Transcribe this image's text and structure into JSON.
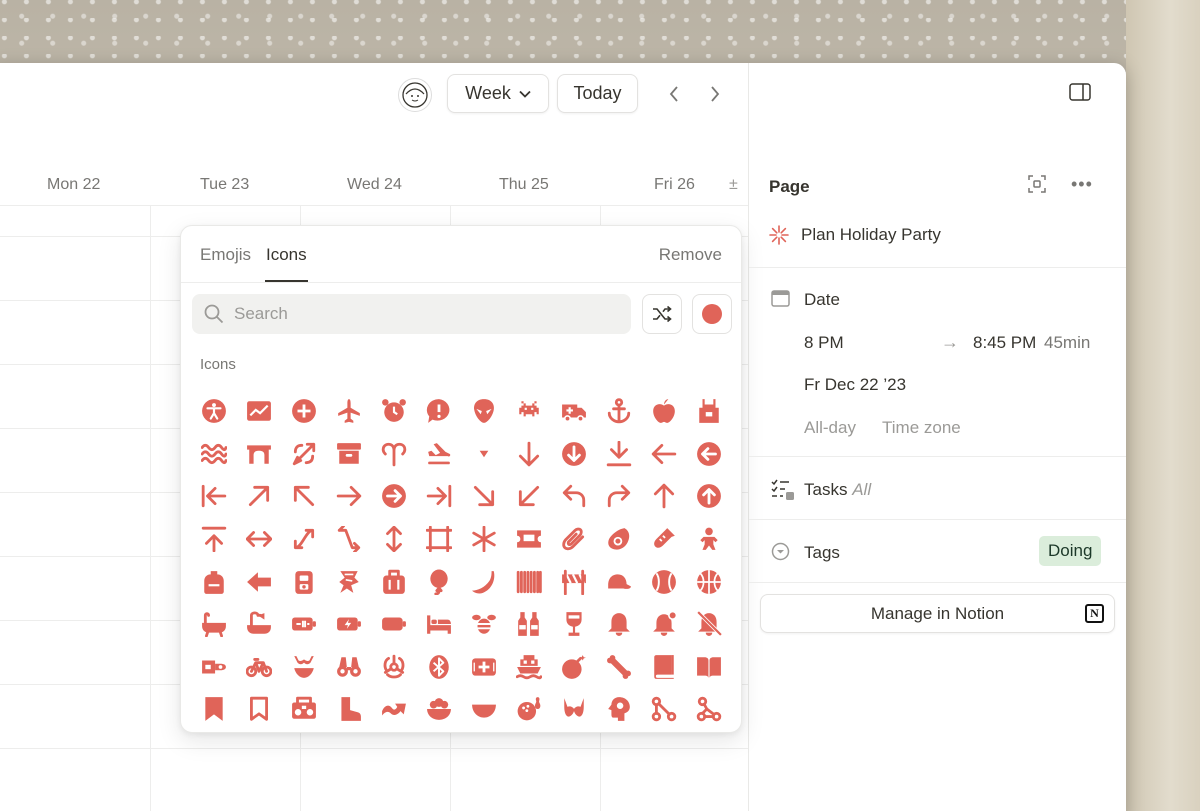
{
  "colors": {
    "accent": "#e06459",
    "tag_bg": "#dbeddb",
    "tag_text": "#1c3829"
  },
  "toolbar": {
    "view_label": "Week",
    "today_label": "Today"
  },
  "calendar": {
    "days": [
      "Mon 22",
      "Tue 23",
      "Wed 24",
      "Thu 25",
      "Fri 26"
    ],
    "more_symbol": "±"
  },
  "picker": {
    "tabs": [
      "Emojis",
      "Icons"
    ],
    "active_tab": "Icons",
    "remove_label": "Remove",
    "search_placeholder": "Search",
    "section_label": "Icons",
    "icons": [
      "accessibility-icon",
      "chart-icon",
      "plus-circle-icon",
      "airplane-icon",
      "alarm-clock-icon",
      "alert-bubble-icon",
      "alien-icon",
      "space-invader-icon",
      "ambulance-icon",
      "anchor-icon",
      "apple-icon",
      "apron-icon",
      "water-waves-icon",
      "arch-icon",
      "archery-icon",
      "archive-box-icon",
      "aries-icon",
      "plane-arrival-icon",
      "caret-down-icon",
      "arrow-down-icon",
      "arrow-down-circle-icon",
      "download-icon",
      "arrow-left-icon",
      "arrow-left-circle-icon",
      "arrow-left-to-line-icon",
      "arrow-up-right-icon",
      "arrow-up-left-icon",
      "arrow-right-icon",
      "arrow-right-circle-icon",
      "arrow-right-to-line-icon",
      "arrow-down-right-icon",
      "arrow-down-left-icon",
      "undo-icon",
      "redo-icon",
      "arrow-up-icon",
      "arrow-up-circle-icon",
      "upload-icon",
      "arrows-horizontal-icon",
      "arrows-diagonal-icon",
      "arrows-swap-icon",
      "arrows-vertical-icon",
      "frame-icon",
      "asterisk-icon",
      "ticket-icon",
      "paperclip-icon",
      "avocado-icon",
      "baby-bottle-icon",
      "baby-icon",
      "backpack-icon",
      "back-arrow-icon",
      "backpack-front-icon",
      "bacon-icon",
      "luggage-icon",
      "balloon-icon",
      "banana-icon",
      "barcode-icon",
      "barrier-icon",
      "baseball-cap-icon",
      "baseball-icon",
      "basketball-icon",
      "bathtub-icon",
      "shower-bath-icon",
      "battery-charging-icon",
      "battery-bolt-icon",
      "battery-icon",
      "bed-icon",
      "bee-icon",
      "beer-bottles-icon",
      "wine-glass-icon",
      "bell-icon",
      "bell-alert-icon",
      "bell-off-icon",
      "bike-rack-icon",
      "bicycle-icon",
      "bikini-icon",
      "binoculars-icon",
      "biohazard-icon",
      "bluetooth-icon",
      "hospital-sign-icon",
      "boat-icon",
      "bomb-icon",
      "bone-icon",
      "book-icon",
      "book-open-icon",
      "bookmark-icon",
      "bookmark-outline-icon",
      "boombox-icon",
      "boot-icon",
      "bounce-arrow-icon",
      "bowl-food-icon",
      "bowl-icon",
      "bowling-icon",
      "bra-icon",
      "brain-head-icon",
      "branch-icon",
      "graph-nodes-icon"
    ]
  },
  "panel": {
    "title": "Page",
    "page_name": "Plan Holiday Party",
    "date_label": "Date",
    "time_start": "8 PM",
    "time_end": "8:45 PM",
    "duration": "45min",
    "date_value": "Fr Dec 22 ’23",
    "all_day": "All-day",
    "time_zone": "Time zone",
    "tasks_label": "Tasks",
    "tasks_filter": "All",
    "tags_label": "Tags",
    "tag_value": "Doing",
    "manage_label": "Manage in Notion",
    "notion_logo_letter": "N"
  }
}
